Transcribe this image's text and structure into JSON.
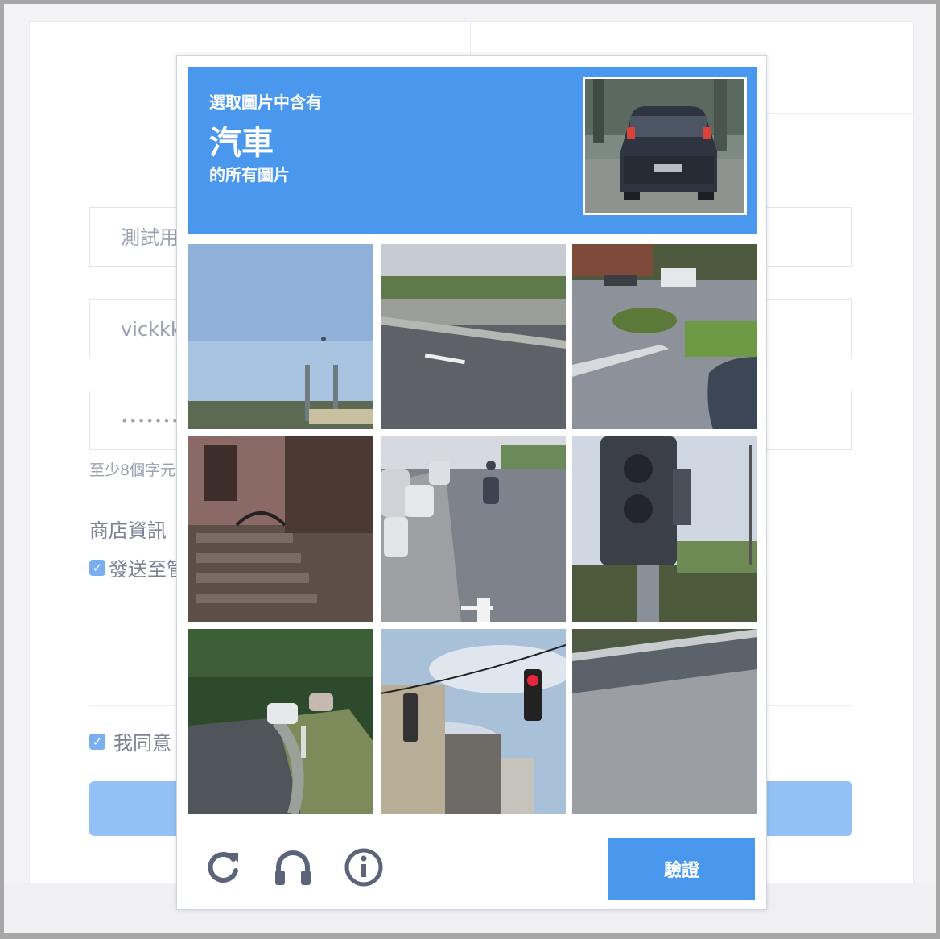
{
  "form": {
    "store_name_value": "測試用",
    "username_value": "vickkk",
    "password_value": "•••••••••",
    "password_hint": "至少8個字元",
    "store_info_label": "商店資訊",
    "send_checkbox_label": "發送至管",
    "agree_checkbox_label": "我同意"
  },
  "captcha": {
    "prompt_line1": "選取圖片中含有",
    "target_object": "汽車",
    "prompt_line2": "的所有圖片",
    "tiles": [
      {
        "id": 1,
        "scene": "sky-and-highway-sign"
      },
      {
        "id": 2,
        "scene": "empty-highway"
      },
      {
        "id": 3,
        "scene": "street-corner-with-cars"
      },
      {
        "id": 4,
        "scene": "brownstone-stairs"
      },
      {
        "id": 5,
        "scene": "street-with-parked-cars-and-scooter"
      },
      {
        "id": 6,
        "scene": "traffic-light-closeup"
      },
      {
        "id": 7,
        "scene": "wooded-road-with-cars"
      },
      {
        "id": 8,
        "scene": "traffic-light-and-buildings"
      },
      {
        "id": 9,
        "scene": "road-with-guardrail"
      }
    ],
    "reload_icon": "reload-icon",
    "audio_icon": "headphones-icon",
    "info_icon": "info-icon",
    "verify_label": "驗證"
  },
  "colors": {
    "captcha_blue": "#4a97ee",
    "submit_disabled": "#93c0f5"
  }
}
